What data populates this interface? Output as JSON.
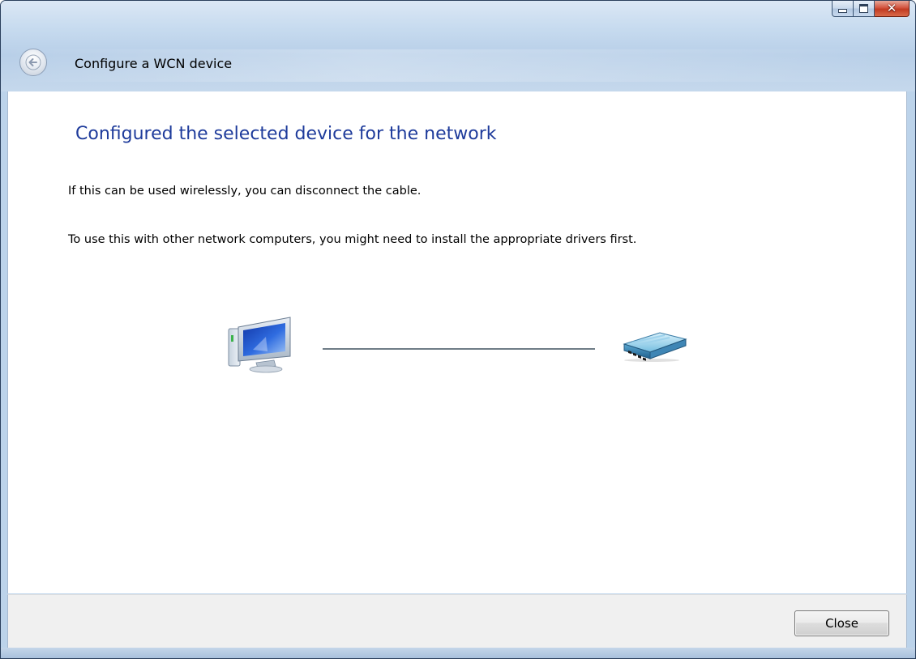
{
  "window": {
    "caption_buttons": {
      "minimize_icon": "minimize-icon",
      "maximize_icon": "maximize-icon",
      "close_glyph": "✕"
    }
  },
  "nav": {
    "back_icon": "back-arrow-icon",
    "title": "Configure a WCN device"
  },
  "content": {
    "main_instruction": "Configured the selected device for the network",
    "line1": "If this  can be used wirelessly, you can disconnect the cable.",
    "line2": "To use this  with other network computers, you might need to install the appropriate drivers first.",
    "diagram": {
      "left_icon": "computer-icon",
      "right_icon": "router-icon"
    }
  },
  "footer": {
    "close_label": "Close"
  },
  "colors": {
    "frame": "#bcd3ea",
    "instruction_text": "#1e3b9b",
    "close_caption_button": "#c23b22"
  }
}
